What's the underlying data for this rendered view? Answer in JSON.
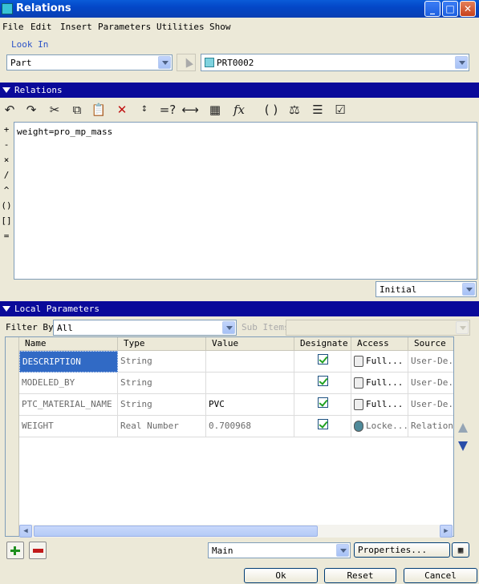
{
  "window": {
    "title": "Relations",
    "buttons": {
      "minimize": "_",
      "maximize": "□",
      "close": "✕"
    }
  },
  "menu": [
    "File",
    "Edit",
    "Insert",
    "Parameters",
    "Utilities",
    "Show"
  ],
  "look_in": {
    "label": "Look In",
    "type_value": "Part",
    "object_value": "PRT0002"
  },
  "relations": {
    "header": "Relations",
    "toolbar_icons": [
      "undo-icon",
      "redo-icon",
      "cut-icon",
      "copy-icon",
      "paste-icon",
      "delete-icon",
      "sort-icon",
      "evaluate-icon",
      "measure-icon",
      "parameter-icon",
      "function-icon",
      "parentheses-icon",
      "verify-icon",
      "units-icon",
      "check-icon"
    ],
    "operators": [
      "+",
      "-",
      "×",
      "/",
      "^",
      "()",
      "[]",
      "="
    ],
    "text": "weight=pro_mp_mass",
    "mode_value": "Initial"
  },
  "local_parameters": {
    "header": "Local Parameters",
    "filter_label": "Filter By",
    "filter_value": "All",
    "sub_items_label": "Sub Items",
    "columns": [
      "Name",
      "Type",
      "Value",
      "Designate",
      "Access",
      "Source"
    ],
    "rows": [
      {
        "name": "DESCRIPTION",
        "type": "String",
        "value": "",
        "designate": true,
        "access": "Full...",
        "source": "User-De..."
      },
      {
        "name": "MODELED_BY",
        "type": "String",
        "value": "",
        "designate": true,
        "access": "Full...",
        "source": "User-De..."
      },
      {
        "name": "PTC_MATERIAL_NAME",
        "type": "String",
        "value": "PVC",
        "designate": true,
        "access": "Full...",
        "source": "User-De..."
      },
      {
        "name": "WEIGHT",
        "type": "Real Number",
        "value": "0.700968",
        "designate": true,
        "access": "Locke...",
        "source": "Relation"
      }
    ],
    "scope_value": "Main",
    "properties_label": "Properties..."
  },
  "footer": {
    "ok_label": "Ok",
    "reset_label": "Reset",
    "cancel_label": "Cancel"
  }
}
